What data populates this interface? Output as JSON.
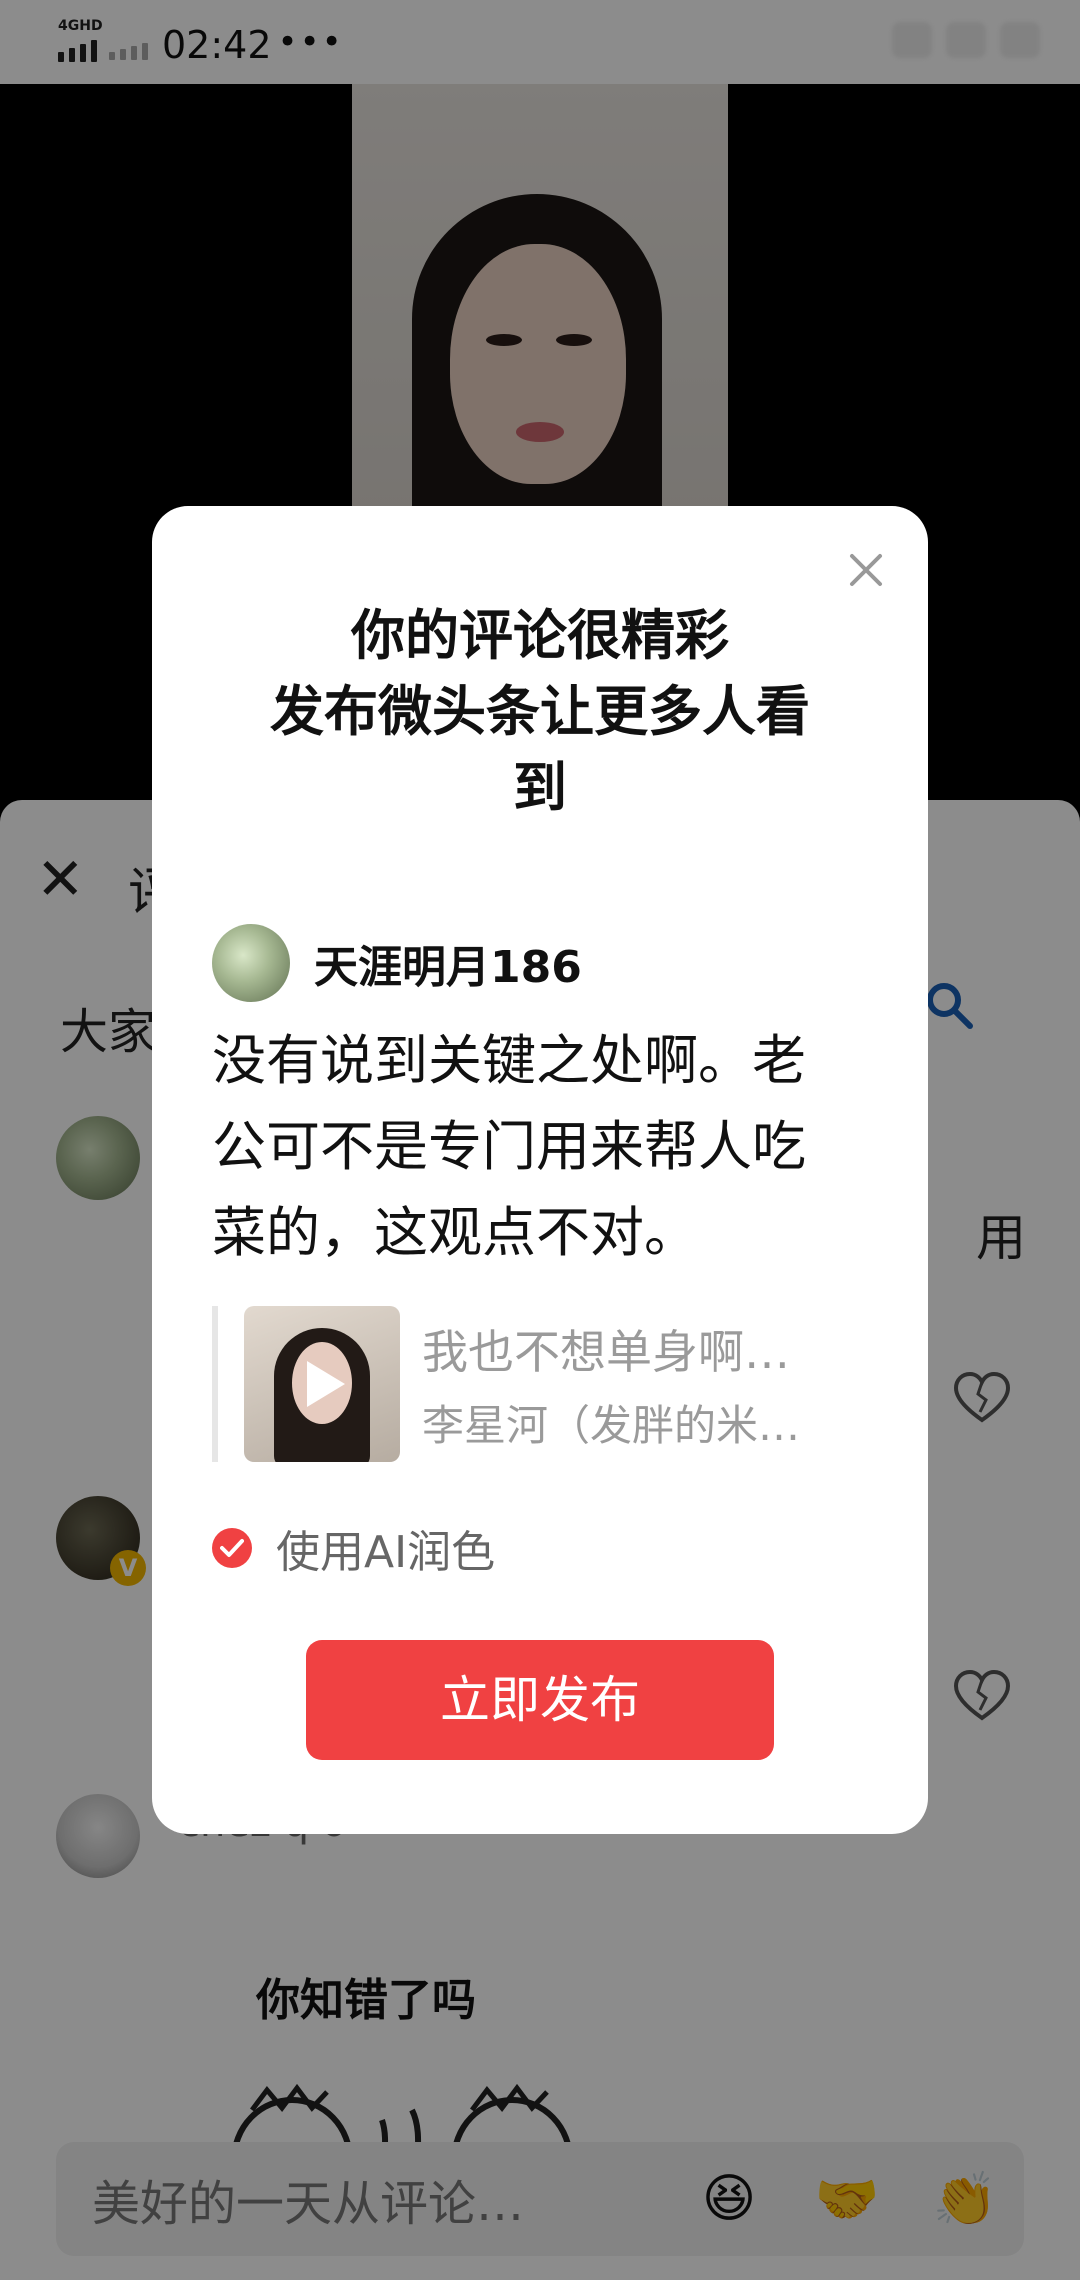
{
  "status_bar": {
    "network": "4GHD",
    "time": "02:42",
    "dots": "•••"
  },
  "behind": {
    "sheet_close": "✕",
    "sheet_title": "评",
    "sheet_subtitle": "大家",
    "comment_snippet": "用",
    "username_partial": "chez q o",
    "meme_caption": "你知错了吗"
  },
  "modal": {
    "title_line1": "你的评论很精彩",
    "title_line2": "发布微头条让更多人看",
    "title_line3": "到",
    "username": "天涯明月186",
    "post_line1": "没有说到关键之处啊。老",
    "post_line2": "公可不是专门用来帮人吃",
    "post_line3": "菜的，这观点不对。",
    "quote_title": "我也不想单身啊…",
    "quote_author": "李星河（发胖的米…",
    "ai_label": "使用AI润色",
    "publish_label": "立即发布"
  },
  "comment_bar": {
    "placeholder": "美好的一天从评论…",
    "emoji_1": "😆",
    "emoji_2": "🤝",
    "emoji_3": "👏"
  },
  "colors": {
    "accent": "#f04142",
    "overlay": "rgba(0,0,0,0.45)"
  }
}
